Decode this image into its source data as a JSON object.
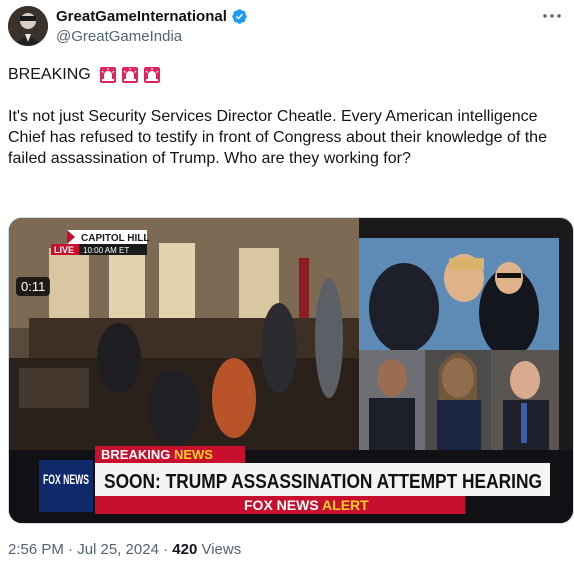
{
  "author": {
    "display_name": "GreatGameInternational",
    "handle": "@GreatGameIndia"
  },
  "tweet": {
    "breaking": "BREAKING",
    "body": "It's not just Security Services Director Cheatle. Every American intelligence Chief has refused to testify in front of Congress about their knowledge of the failed assassination of Trump. Who are they working for?"
  },
  "video": {
    "location_tag": "CAPITOL HILL",
    "live_label": "LIVE",
    "live_time": "10:00 AM ET",
    "breaking_news_1": "BREAKING",
    "breaking_news_2": "NEWS",
    "headline": "SOON: TRUMP ASSASSINATION ATTEMPT HEARING",
    "fox_alert_1": "FOX NEWS",
    "fox_alert_2": "ALERT",
    "channel_logo": "FOX NEWS",
    "duration": "0:11"
  },
  "meta": {
    "time": "2:56 PM · Jul 25, 2024 · ",
    "views_count": "420",
    "views_label": " Views"
  },
  "colors": {
    "verified": "#1d9bf0",
    "fox_red": "#c8102e",
    "alert_yellow": "#ffd21f"
  },
  "icons": {
    "verified": "verified-badge-icon",
    "more": "more-options-icon",
    "siren": "rotating-light-icon"
  }
}
